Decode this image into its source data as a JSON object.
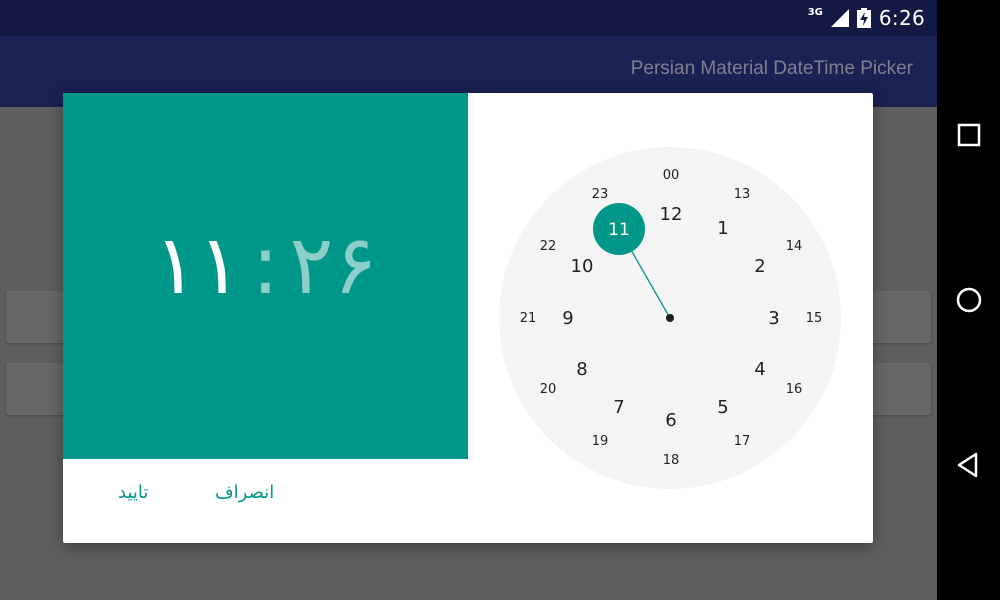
{
  "status_bar": {
    "network_type": "3G",
    "time": "6:26"
  },
  "app_bar": {
    "title": "Persian Material DateTime Picker"
  },
  "dialog": {
    "hour": "۱۱",
    "separator": ":",
    "minute": "۲۶",
    "accent_color": "#009688",
    "clock": {
      "selected_hour": "11",
      "outer_numbers": [
        "12",
        "1",
        "2",
        "3",
        "4",
        "5",
        "6",
        "7",
        "8",
        "9",
        "10",
        "11"
      ],
      "inner_numbers": [
        "00",
        "13",
        "14",
        "15",
        "16",
        "17",
        "18",
        "19",
        "20",
        "21",
        "22",
        "23"
      ]
    },
    "buttons": {
      "confirm_label": "تایید",
      "cancel_label": "انصراف"
    }
  },
  "nav_bar": {
    "icons": [
      "recents-icon",
      "home-icon",
      "back-icon"
    ]
  }
}
